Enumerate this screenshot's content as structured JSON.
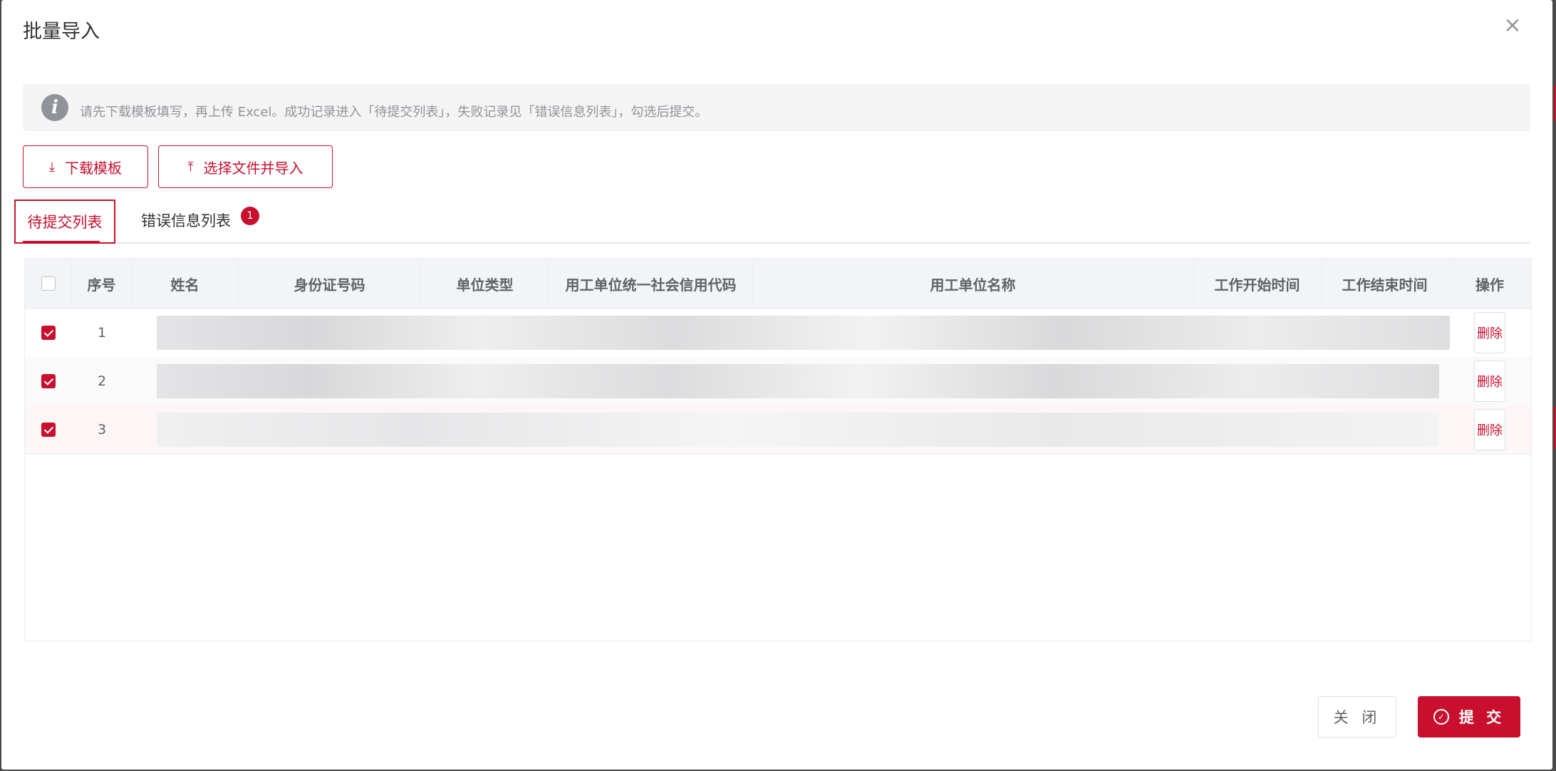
{
  "dialog": {
    "title": "批量导入",
    "close_icon": "close-icon"
  },
  "alert": {
    "icon": "info-icon",
    "text": "请先下载模板填写，再上传 Excel。成功记录进入「待提交列表」，失败记录见「错误信息列表」，勾选后提交。"
  },
  "toolbar": {
    "download_label": "下载模板",
    "download_icon": "download-icon",
    "upload_label": "选择文件并导入",
    "upload_icon": "upload-icon"
  },
  "tabs": [
    {
      "label": "待提交列表",
      "active": true
    },
    {
      "label": "错误信息列表",
      "active": false,
      "badge": "1"
    }
  ],
  "table": {
    "columns": [
      "序号",
      "姓名",
      "身份证号码",
      "单位类型",
      "用工单位统一社会信用代码",
      "用工单位名称",
      "工作开始时间",
      "工作结束时间",
      "操作"
    ],
    "rows": [
      {
        "index": "1",
        "checked": true,
        "action": "删除"
      },
      {
        "index": "2",
        "checked": true,
        "action": "删除"
      },
      {
        "index": "3",
        "checked": true,
        "action": "删除"
      }
    ]
  },
  "footer": {
    "close_label": "关 闭",
    "submit_label": "提 交",
    "submit_icon": "check-circle-icon"
  },
  "colors": {
    "primary": "#c8102e",
    "header_bg": "#f2f4f8",
    "alert_bg": "#f4f4f5"
  }
}
